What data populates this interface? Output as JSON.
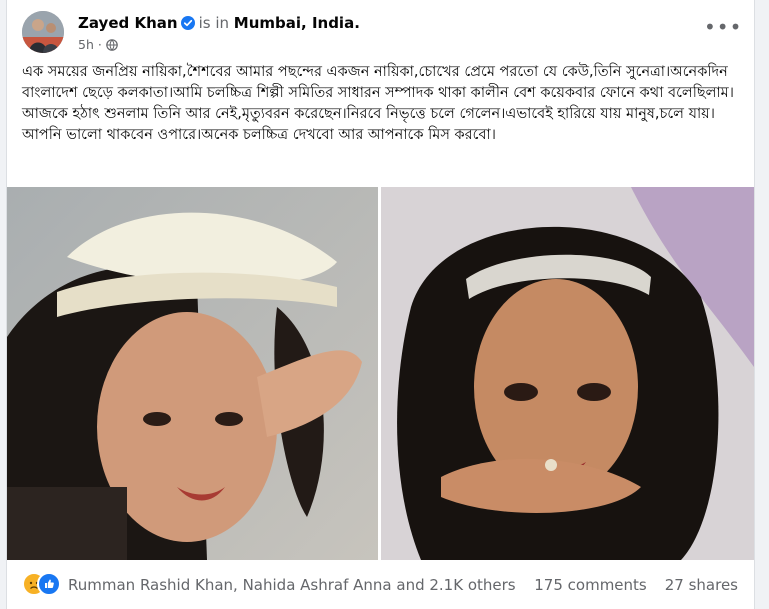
{
  "post": {
    "author": "Zayed Khan",
    "is_in": "is in",
    "location": "Mumbai, India.",
    "time": "5h",
    "more_label": "•••",
    "text": "এক সময়ের জনপ্রিয় নায়িকা,শৈশবের আমার পছন্দের একজন নায়িকা,চোখের প্রেমে পরতো যে কেউ,তিনি সুনেত্রা।অনেকদিন বাংলাদেশ ছেড়ে কলকাতা।আমি চলচ্চিত্র শিল্পী সমিতির সাধারন সম্পাদক থাকা কালীন বেশ কয়েকবার ফোনে কথা বলেছিলাম।আজকে হঠাৎ শুনলাম তিনি আর নেই,মৃত্যুবরন করেছেন।নিরবে নিভৃত্তে চলে গেলেন।এভাবেই হারিয়ে যায় মানুষ,চলে যায়।আপনি ভালো থাকবেন ওপারে।অনেক চলচ্চিত্র দেখবো আর আপনাকে মিস করবো।"
  },
  "reactions": {
    "reactors": "Rumman Rashid Khan, Nahida Ashraf Anna and 2.1K others",
    "comments": "175 comments",
    "shares": "27 shares",
    "icons": [
      "sad-icon",
      "like-icon"
    ]
  },
  "colors": {
    "like_blue": "#1877f2",
    "sad_yellow": "#f7b125",
    "muted_text": "#65676b",
    "page_bg": "#f0f2f5"
  }
}
